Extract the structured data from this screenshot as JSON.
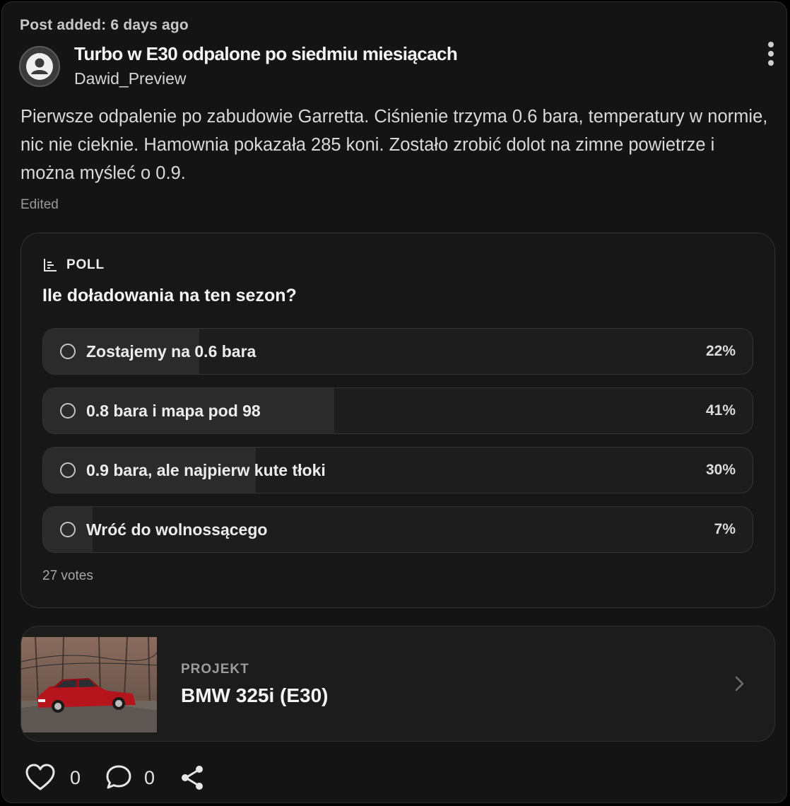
{
  "post": {
    "added_label": "Post added: 6 days ago",
    "title": "Turbo w E30 odpalone po siedmiu miesiącach",
    "author": "Dawid_Preview",
    "body": "Pierwsze odpalenie po zabudowie Garretta. Ciśnienie trzyma 0.6 bara, temperatury w normie, nic nie cieknie. Hamownia pokazała 285 koni. Zostało zrobić dolot na zimne powietrze i można myśleć o 0.9.",
    "edited_label": "Edited"
  },
  "poll": {
    "label": "POLL",
    "question": "Ile doładowania na ten sezon?",
    "options": [
      {
        "label": "Zostajemy na 0.6 bara",
        "percent_label": "22%",
        "percent": 22
      },
      {
        "label": "0.8 bara i mapa pod 98",
        "percent_label": "41%",
        "percent": 41
      },
      {
        "label": "0.9 bara, ale najpierw kute tłoki",
        "percent_label": "30%",
        "percent": 30
      },
      {
        "label": "Wróć do wolnossącego",
        "percent_label": "7%",
        "percent": 7
      }
    ],
    "votes_label": "27 votes"
  },
  "project": {
    "kicker": "PROJEKT",
    "name": "BMW 325i (E30)"
  },
  "actions": {
    "likes": "0",
    "comments": "0"
  },
  "colors": {
    "background": "#141414",
    "poll_fill": "#2b2b2b",
    "car_red": "#b5141c"
  }
}
